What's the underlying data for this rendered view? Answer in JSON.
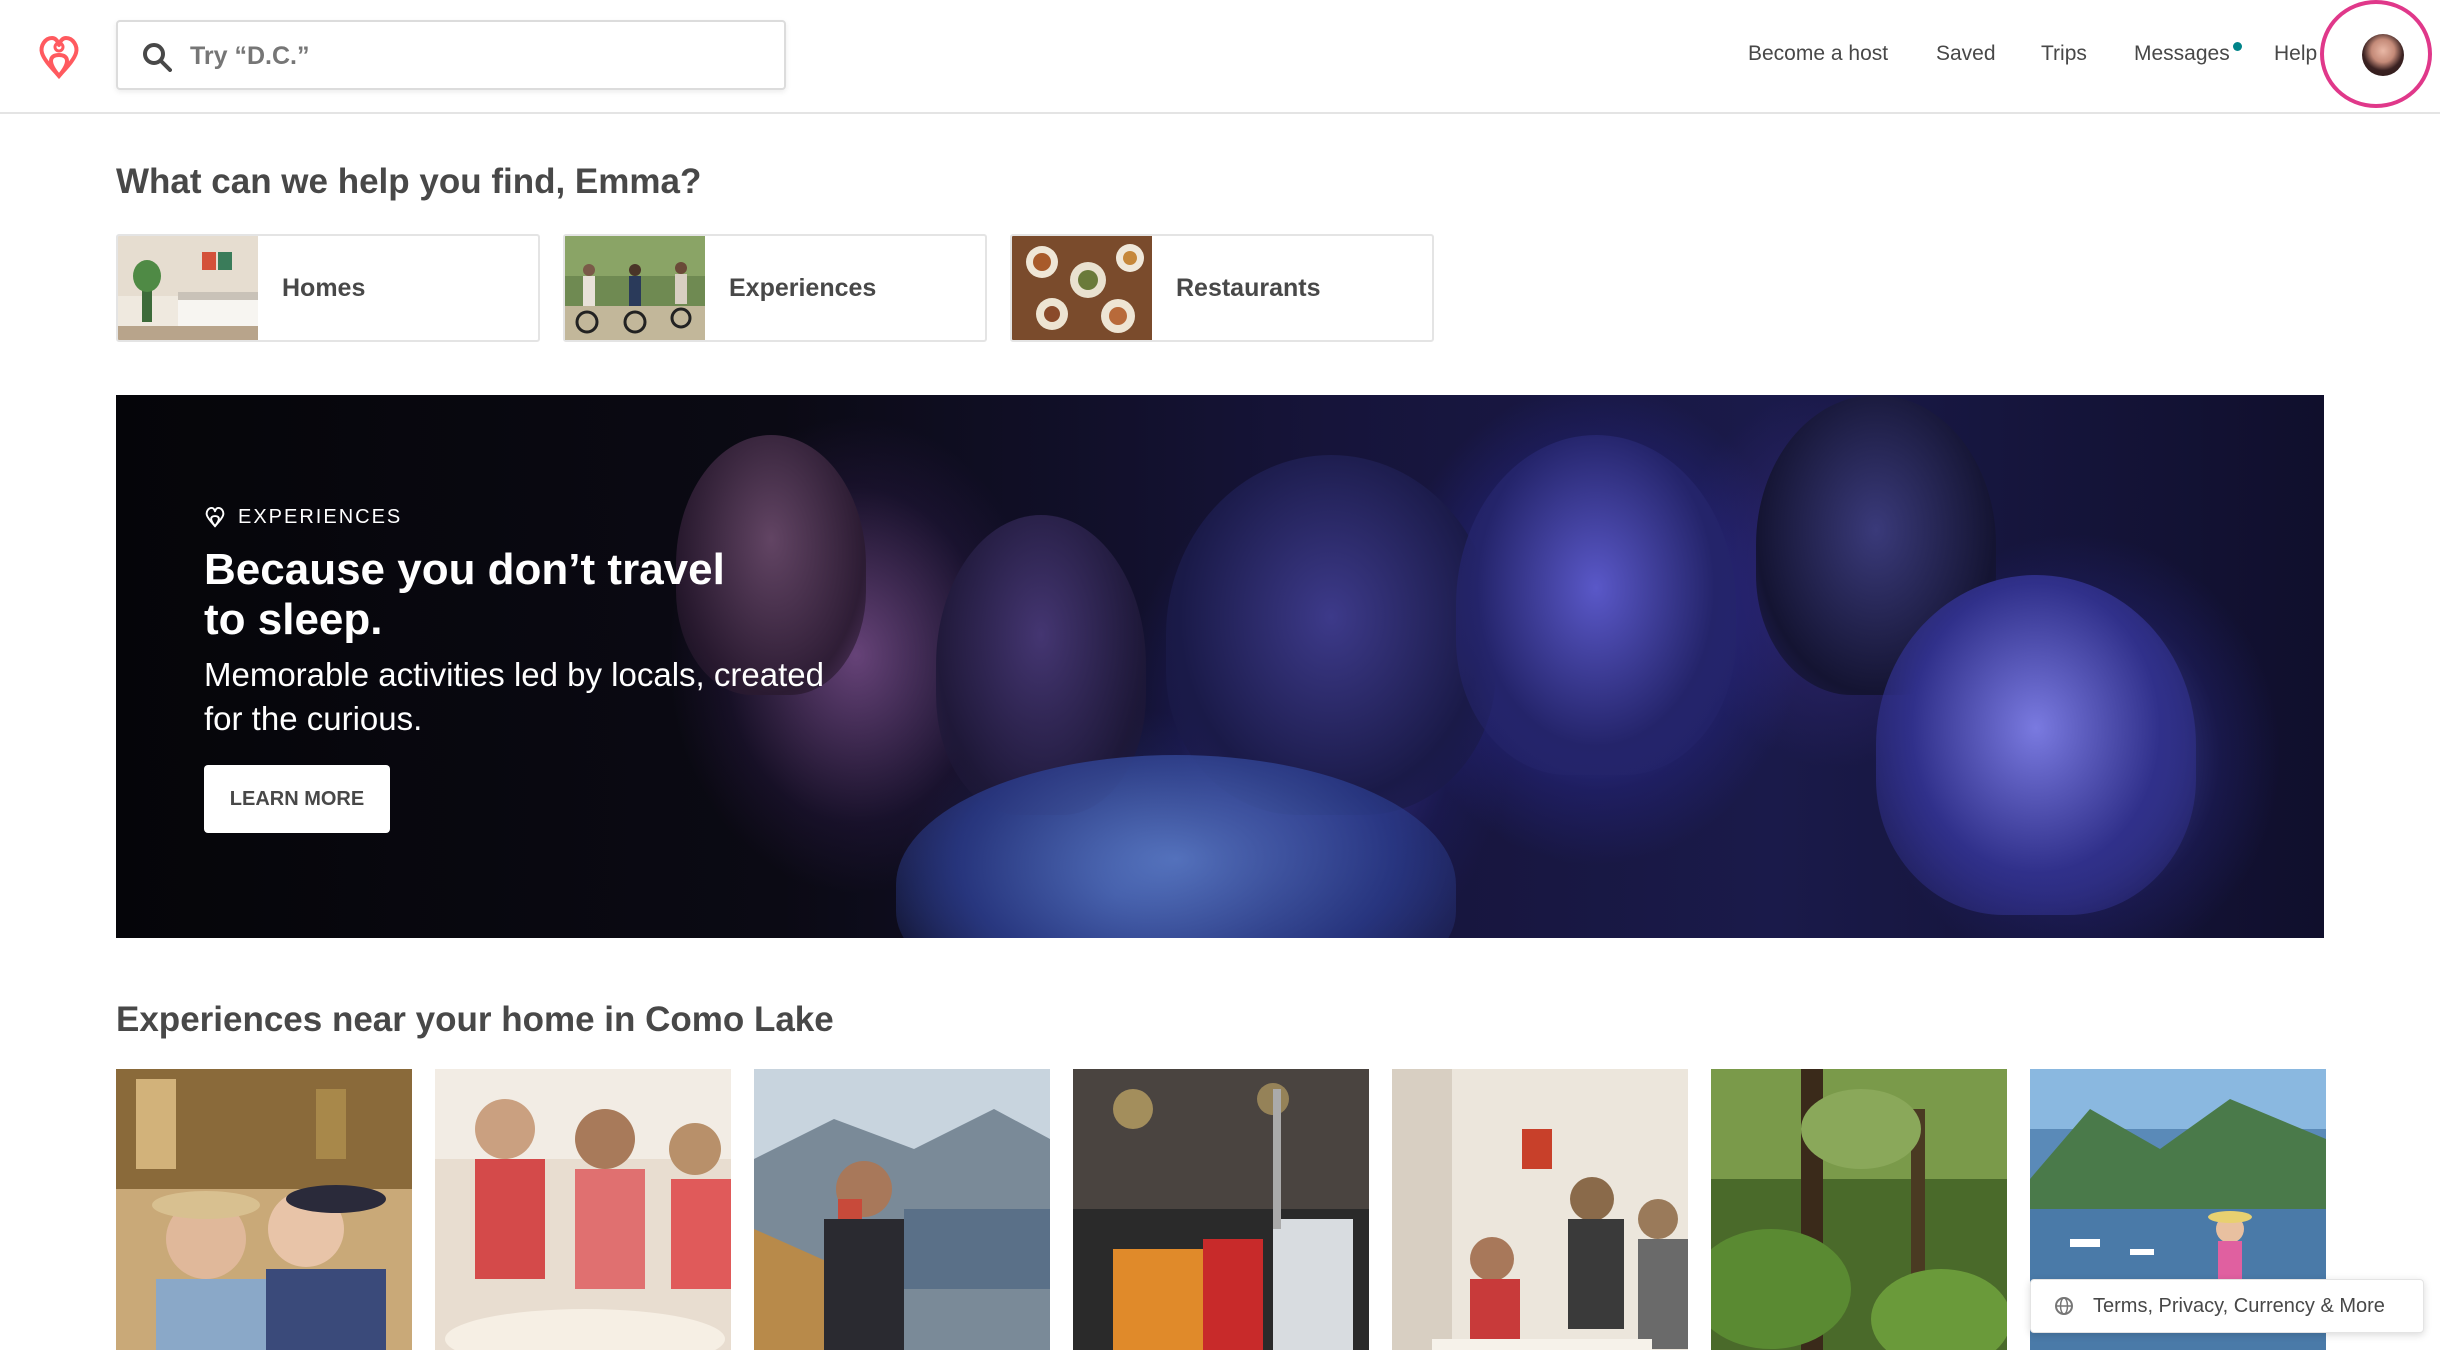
{
  "header": {
    "logo_icon": "airbnb-belo-icon",
    "brand_color": "#FF5A5F",
    "search": {
      "placeholder": "Try “D.C.”",
      "icon": "search-icon"
    },
    "nav": {
      "become_host": "Become a host",
      "saved": "Saved",
      "trips": "Trips",
      "messages": "Messages",
      "help": "Help"
    },
    "messages_dot_color": "#008489",
    "avatar_highlight_color": "#E0388A"
  },
  "greeting": "What can we help you find, Emma?",
  "categories": [
    {
      "label": "Homes"
    },
    {
      "label": "Experiences"
    },
    {
      "label": "Restaurants"
    }
  ],
  "hero": {
    "badge": "EXPERIENCES",
    "badge_icon": "airbnb-belo-icon",
    "title": "Because you don’t travel to sleep.",
    "subtitle": "Memorable activities led by locals, created for the curious.",
    "button": "LEARN MORE"
  },
  "experiences": {
    "title": "Experiences near your home in Como Lake",
    "cards": 7
  },
  "footer": {
    "icon": "globe-icon",
    "label": "Terms, Privacy, Currency & More"
  }
}
